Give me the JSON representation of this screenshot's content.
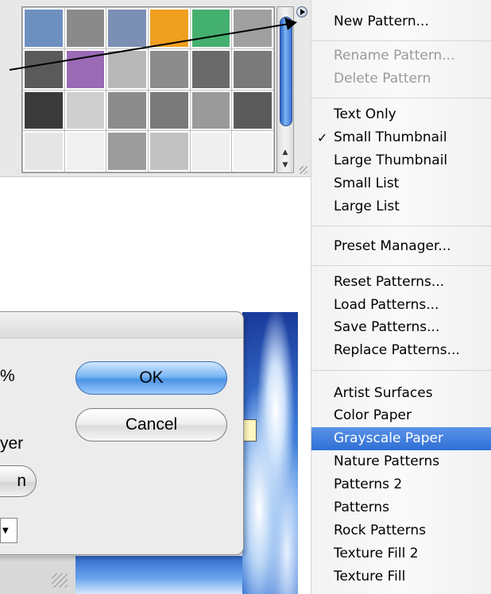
{
  "picker": {
    "swatch_colors": [
      "#6e90c0",
      "#8a8a8a",
      "#7c8fb4",
      "#f0a020",
      "#44b070",
      "#a0a0a0",
      "#5a5a5a",
      "#9a6ab4",
      "#b8b8b8",
      "#8c8c8c",
      "#6a6a6a",
      "#7a7a7a",
      "#3a3a3a",
      "#cfcfcf",
      "#8c8c8c",
      "#7a7a7a",
      "#9a9a9a",
      "#5a5a5a",
      "#e6e6e6",
      "#f0f0f0",
      "#9c9c9c",
      "#c2c2c2",
      "#efefef",
      "#f2f2f2"
    ]
  },
  "menu": {
    "new_pattern": "New Pattern...",
    "rename_pattern": "Rename Pattern...",
    "delete_pattern": "Delete Pattern",
    "text_only": "Text Only",
    "small_thumbnail": "Small Thumbnail",
    "large_thumbnail": "Large Thumbnail",
    "small_list": "Small List",
    "large_list": "Large List",
    "preset_manager": "Preset Manager...",
    "reset_patterns": "Reset Patterns...",
    "load_patterns": "Load Patterns...",
    "save_patterns": "Save Patterns...",
    "replace_patterns": "Replace Patterns...",
    "artist_surfaces": "Artist Surfaces",
    "color_paper": "Color Paper",
    "grayscale_paper": "Grayscale Paper",
    "nature_patterns": "Nature Patterns",
    "patterns_2": "Patterns 2",
    "patterns": "Patterns",
    "rock_patterns": "Rock Patterns",
    "texture_fill_2": "Texture Fill 2",
    "texture_fill": "Texture Fill",
    "checkmark": "✓"
  },
  "dialog": {
    "ok_label": "OK",
    "cancel_label": "Cancel",
    "percent_fragment": "%",
    "layer_fragment": "yer",
    "button_fragment": "n"
  },
  "colors": {
    "selection": "#3b7be0",
    "ok_button": "#5aa0ee"
  }
}
